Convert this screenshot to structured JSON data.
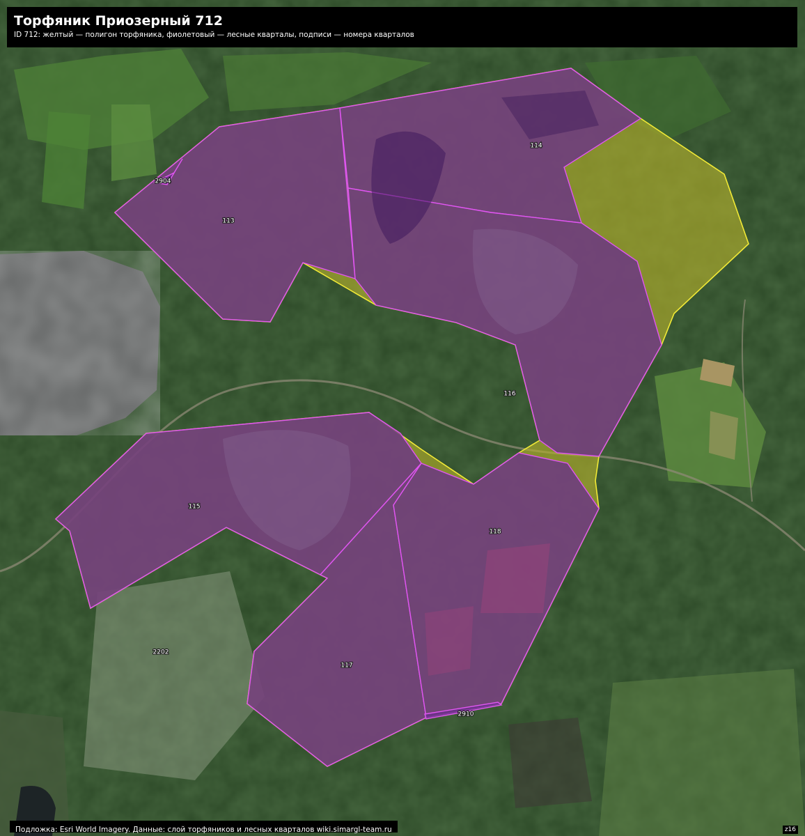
{
  "header": {
    "title": "Торфяник Приозерный 712",
    "subtitle": "ID 712: желтый — полигон торфяника, фиолетовый — лесные кварталы, подписи — номера кварталов"
  },
  "footer": {
    "attribution": "Подложка: Esri World Imagery. Данные: слой торфяников и лесных кварталов wiki.simargl-team.ru",
    "zoom": "z16"
  },
  "colors": {
    "peat_outline": "#f2ea36",
    "peat_fill": "#b9b52a",
    "quarter_outline": "#e056f0",
    "quarter_fill": "#6a2f8a",
    "lake": "#626464",
    "forest": "#284a26",
    "meadow": "#4f7f39"
  },
  "quarters": [
    {
      "id": "113",
      "label": "113"
    },
    {
      "id": "114",
      "label": "114"
    },
    {
      "id": "115",
      "label": "115"
    },
    {
      "id": "116",
      "label": "116"
    },
    {
      "id": "117",
      "label": "117"
    },
    {
      "id": "118",
      "label": "118"
    },
    {
      "id": "2904",
      "label": "2904"
    },
    {
      "id": "2910",
      "label": "2910"
    },
    {
      "id": "2202",
      "label": "2202"
    }
  ]
}
